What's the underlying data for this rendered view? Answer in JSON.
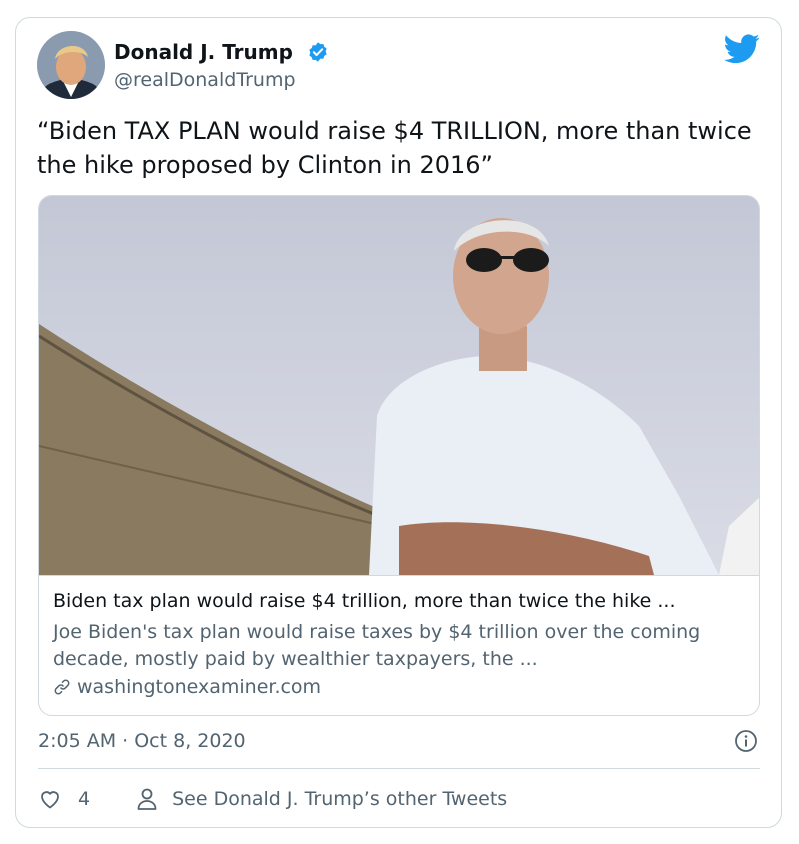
{
  "author": {
    "name": "Donald J. Trump",
    "handle": "@realDonaldTrump",
    "verified": true
  },
  "tweet": {
    "text": "“Biden TAX PLAN would raise $4 TRILLION, more than twice the hike proposed by Clinton in 2016”"
  },
  "link_card": {
    "title": "Biden tax plan would raise $4 trillion, more than twice the hike ...",
    "description": "Joe Biden's tax plan would raise taxes by $4 trillion over the coming decade, mostly paid by wealthier taxpayers, the ...",
    "domain": "washingtonexaminer.com"
  },
  "meta": {
    "timestamp": "2:05 AM · Oct 8, 2020"
  },
  "actions": {
    "like_count": "4",
    "other_tweets_label": "See Donald J. Trump’s other Tweets"
  },
  "colors": {
    "twitter_blue": "#1d9bf0",
    "text_primary": "#0f1419",
    "text_secondary": "#536471",
    "border": "#cfd9de"
  },
  "icons": [
    "twitter-bird-icon",
    "verified-badge-icon",
    "link-icon",
    "info-icon",
    "heart-icon",
    "person-icon"
  ]
}
